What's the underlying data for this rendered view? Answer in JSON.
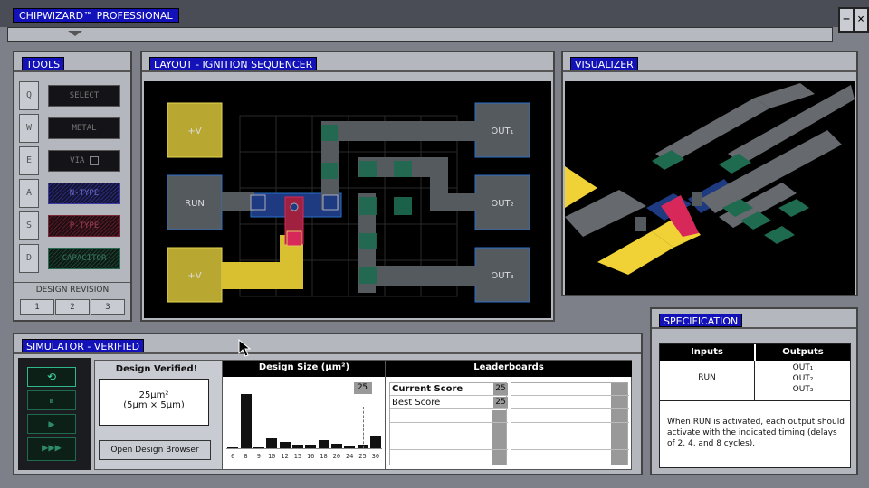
{
  "app": {
    "title": "CHIPWIZARD™ PROFESSIONAL"
  },
  "tools": {
    "title": "TOOLS",
    "items": [
      {
        "key": "Q",
        "label": "SELECT"
      },
      {
        "key": "W",
        "label": "METAL"
      },
      {
        "key": "E",
        "label": "VIA"
      },
      {
        "key": "A",
        "label": "N-TYPE"
      },
      {
        "key": "S",
        "label": "P-TYPE"
      },
      {
        "key": "D",
        "label": "CAPACITOR"
      }
    ],
    "revision_label": "DESIGN REVISION",
    "revisions": [
      "1",
      "2",
      "3"
    ]
  },
  "layout": {
    "title": "LAYOUT - IGNITION SEQUENCER",
    "pins": {
      "vplus_top": "+V",
      "run": "RUN",
      "vplus_bottom": "+V",
      "out1": "OUT₁",
      "out2": "OUT₂",
      "out3": "OUT₃"
    }
  },
  "visualizer": {
    "title": "VISUALIZER"
  },
  "simulator": {
    "title": "SIMULATOR - VERIFIED",
    "controls": [
      "⟲",
      "⏸",
      "▶",
      "▶▶▶"
    ],
    "verified_title": "Design Verified!",
    "size_line1": "25μm²",
    "size_line2": "(5μm × 5μm)",
    "browser_button": "Open Design Browser"
  },
  "design_size": {
    "title": "Design Size (μm²)",
    "marker": "25"
  },
  "chart_data": {
    "type": "bar",
    "title": "Design Size (μm²)",
    "categories": [
      "6",
      "8",
      "9",
      "10",
      "12",
      "15",
      "16",
      "18",
      "20",
      "24",
      "25",
      "30"
    ],
    "values": [
      1,
      45,
      1,
      8,
      5,
      3,
      3,
      7,
      4,
      2,
      3,
      10
    ],
    "highlight": "25"
  },
  "leaderboards": {
    "title": "Leaderboards",
    "current_label": "Current Score",
    "current_value": "25",
    "best_label": "Best Score",
    "best_value": "25"
  },
  "specification": {
    "title": "SPECIFICATION",
    "inputs_header": "Inputs",
    "outputs_header": "Outputs",
    "input": "RUN",
    "out1": "OUT₁",
    "out2": "OUT₂",
    "out3": "OUT₃",
    "description": "When RUN is activated, each output should activate with the indicated timing (delays of 2, 4, and 8 cycles)."
  },
  "colors": {
    "accent": "#1212b8",
    "metal": "#555a5f",
    "via_blue": "#2260c0",
    "n_type": "#1e6b50",
    "p_type": "#d8285a",
    "power": "#f0d236"
  }
}
